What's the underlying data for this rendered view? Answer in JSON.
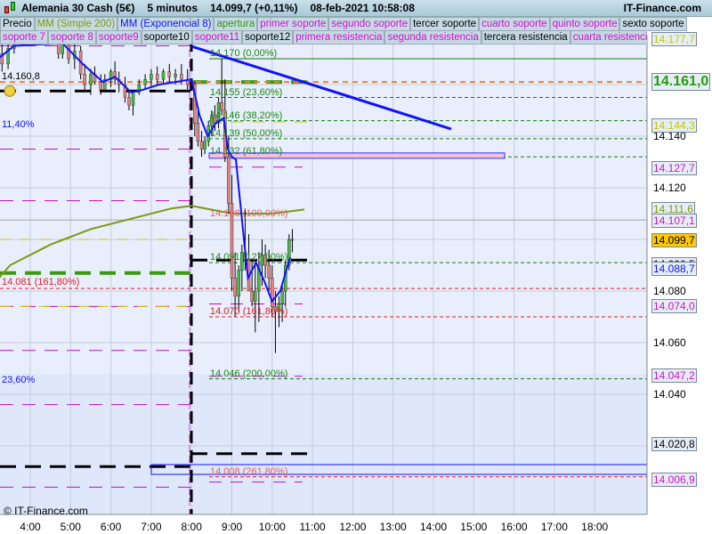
{
  "title": {
    "instrument": "Alemania 30 Cash (5€)",
    "timeframe": "5 minutos",
    "price": "14.099,7 (+0,11%)",
    "datetime": "08-feb-2021 10:58:08",
    "brand": "IT-Finance.com"
  },
  "legend_row1": [
    {
      "label": "Precio",
      "color": "#000000"
    },
    {
      "label": "MM (Simple 200)",
      "color": "#7a9a10"
    },
    {
      "label": "MM (Exponencial 8)",
      "color": "#1010ff"
    },
    {
      "label": "apertura",
      "color": "#2a9a10"
    },
    {
      "label": "primer soporte",
      "color": "#d010d0"
    },
    {
      "label": "segundo soporte",
      "color": "#d010d0"
    },
    {
      "label": "tercer soporte",
      "color": "#000000"
    },
    {
      "label": "cuarto soporte",
      "color": "#d010d0"
    },
    {
      "label": "quinto soporte",
      "color": "#d010d0"
    },
    {
      "label": "sexto soporte",
      "color": "#000000"
    }
  ],
  "legend_row2": [
    {
      "label": "soporte 7",
      "color": "#d010d0"
    },
    {
      "label": "soporte 8",
      "color": "#d010d0"
    },
    {
      "label": "soporte9",
      "color": "#d010d0"
    },
    {
      "label": "soporte10",
      "color": "#000000"
    },
    {
      "label": "soporte11",
      "color": "#d010d0"
    },
    {
      "label": "soporte12",
      "color": "#000000"
    },
    {
      "label": "primera resistencia",
      "color": "#d010d0"
    },
    {
      "label": "segunda resistencia",
      "color": "#d010d0"
    },
    {
      "label": "tercera resistencia",
      "color": "#000000"
    },
    {
      "label": "cuarta resistencia",
      "color": "#d010d0"
    },
    {
      "label": "quinta resistencia",
      "color": "#d010d0"
    }
  ],
  "price_labels": [
    {
      "text": "14.177,7",
      "price": 14177.7,
      "color": "#c8c800",
      "bg": "#e6eef5"
    },
    {
      "text": "14.161,0",
      "price": 14161.0,
      "color": "#2a9a10",
      "bg": "#e6eef5",
      "big": true
    },
    {
      "text": "14.144,3",
      "price": 14144.3,
      "color": "#c8c800",
      "bg": "#e6eef5"
    },
    {
      "text": "14.127,7",
      "price": 14127.7,
      "color": "#d010d0",
      "bg": "#e6eef5"
    },
    {
      "text": "14.111,6",
      "price": 14111.6,
      "color": "#7a9a10",
      "bg": "#e6eef5"
    },
    {
      "text": "14.107,1",
      "price": 14107.1,
      "color": "#d010d0",
      "bg": "#e6eef5"
    },
    {
      "text": "14.099,7",
      "price": 14099.7,
      "color": "#000000",
      "bg": "#ffc800"
    },
    {
      "text": "14.090,5",
      "price": 14090.5,
      "color": "#000000",
      "bg": "#e6eef5"
    },
    {
      "text": "14.088,7",
      "price": 14088.7,
      "color": "#1010ff",
      "bg": "#e6eef5"
    },
    {
      "text": "14.074,0",
      "price": 14074.0,
      "color": "#d010d0",
      "bg": "#e6eef5"
    },
    {
      "text": "14.047,2",
      "price": 14047.2,
      "color": "#d010d0",
      "bg": "#e6eef5"
    },
    {
      "text": "14.020,8",
      "price": 14020.8,
      "color": "#000000",
      "bg": "#e6eef5"
    },
    {
      "text": "14.006,9",
      "price": 14006.9,
      "color": "#d010d0",
      "bg": "#e6eef5"
    }
  ],
  "y_ticks": [
    {
      "text": "14.140",
      "price": 14140
    },
    {
      "text": "14.120",
      "price": 14120
    },
    {
      "text": "14.080",
      "price": 14080
    },
    {
      "text": "14.060",
      "price": 14060
    },
    {
      "text": "14.040",
      "price": 14040
    }
  ],
  "x_ticks": [
    {
      "text": "4:00",
      "h": 4
    },
    {
      "text": "5:00",
      "h": 5
    },
    {
      "text": "6:00",
      "h": 6
    },
    {
      "text": "7:00",
      "h": 7
    },
    {
      "text": "8:00",
      "h": 8
    },
    {
      "text": "9:00",
      "h": 9
    },
    {
      "text": "10:00",
      "h": 10
    },
    {
      "text": "11:00",
      "h": 11
    },
    {
      "text": "12:00",
      "h": 12
    },
    {
      "text": "13:00",
      "h": 13
    },
    {
      "text": "14:00",
      "h": 14
    },
    {
      "text": "15:00",
      "h": 15
    },
    {
      "text": "16:00",
      "h": 16
    },
    {
      "text": "17:00",
      "h": 17
    },
    {
      "text": "18:00",
      "h": 18
    }
  ],
  "fib_labels": [
    {
      "text": "14.170 (0,00%)",
      "price": 14170,
      "color": "#1a8a10"
    },
    {
      "text": "14.155 (23,60%)",
      "price": 14155,
      "color": "#1a8a10"
    },
    {
      "text": "14.146 (38,20%)",
      "price": 14146,
      "color": "#1a8a10"
    },
    {
      "text": "14.139 (50,00%)",
      "price": 14139,
      "color": "#1a8a10"
    },
    {
      "text": "14.132 (61,80%)",
      "price": 14132,
      "color": "#1a8a10"
    },
    {
      "text": "14.108 (100,00%)",
      "price": 14108,
      "color": "#e06060"
    },
    {
      "text": "14.091 (127,00%)",
      "price": 14091,
      "color": "#1a8a10"
    },
    {
      "text": "14.070 (161,80%)",
      "price": 14070,
      "color": "#e02020"
    },
    {
      "text": "14.046 (200,00%)",
      "price": 14046,
      "color": "#1a8a10"
    },
    {
      "text": "14.008 (261,80%)",
      "price": 14008,
      "color": "#e06060"
    }
  ],
  "left_labels": [
    {
      "text": "14.160,8",
      "price": 14160.8,
      "color": "#000000"
    },
    {
      "text": "11,40%",
      "price": 14142,
      "color": "#1010ff"
    },
    {
      "text": "14.081 (161,80%)",
      "price": 14081,
      "color": "#e02020"
    },
    {
      "text": "23,60%",
      "price": 14043,
      "color": "#1010ff"
    }
  ],
  "copyright": "© IT-Finance.com",
  "candles": [
    [
      3.3,
      14172,
      14178,
      14165,
      14168
    ],
    [
      3.45,
      14168,
      14176,
      14166,
      14174
    ],
    [
      3.6,
      14174,
      14180,
      14172,
      14178
    ],
    [
      4.7,
      14176,
      14180,
      14170,
      14172
    ],
    [
      4.8,
      14172,
      14178,
      14170,
      14176
    ],
    [
      4.95,
      14176,
      14179,
      14168,
      14170
    ],
    [
      5.1,
      14170,
      14177,
      14166,
      14173
    ],
    [
      5.25,
      14173,
      14175,
      14162,
      14164
    ],
    [
      5.35,
      14164,
      14168,
      14158,
      14160
    ],
    [
      5.5,
      14160,
      14166,
      14156,
      14164
    ],
    [
      5.6,
      14164,
      14167,
      14160,
      14161
    ],
    [
      5.75,
      14161,
      14164,
      14156,
      14158
    ],
    [
      5.85,
      14158,
      14164,
      14157,
      14162
    ],
    [
      6.0,
      14162,
      14166,
      14159,
      14165
    ],
    [
      6.1,
      14165,
      14169,
      14160,
      14162
    ],
    [
      6.2,
      14162,
      14165,
      14157,
      14160
    ],
    [
      6.35,
      14160,
      14163,
      14153,
      14155
    ],
    [
      6.45,
      14155,
      14158,
      14150,
      14152
    ],
    [
      6.55,
      14152,
      14158,
      14148,
      14157
    ],
    [
      6.7,
      14157,
      14162,
      14156,
      14160
    ],
    [
      6.85,
      14160,
      14164,
      14158,
      14162
    ],
    [
      7.0,
      14162,
      14166,
      14159,
      14164
    ],
    [
      7.15,
      14164,
      14167,
      14160,
      14162
    ],
    [
      7.3,
      14162,
      14166,
      14160,
      14165
    ],
    [
      7.45,
      14165,
      14168,
      14161,
      14163
    ],
    [
      7.6,
      14163,
      14166,
      14160,
      14164
    ],
    [
      7.75,
      14164,
      14168,
      14160,
      14162
    ],
    [
      7.9,
      14162,
      14166,
      14158,
      14160
    ],
    [
      8.08,
      14160,
      14161,
      14140,
      14145
    ],
    [
      8.16,
      14145,
      14150,
      14136,
      14138
    ],
    [
      8.25,
      14138,
      14142,
      14132,
      14135
    ],
    [
      8.33,
      14135,
      14140,
      14133,
      14138
    ],
    [
      8.42,
      14138,
      14146,
      14136,
      14144
    ],
    [
      8.5,
      14144,
      14150,
      14140,
      14148
    ],
    [
      8.58,
      14148,
      14152,
      14142,
      14145
    ],
    [
      8.67,
      14145,
      14155,
      14143,
      14153
    ],
    [
      8.75,
      14153,
      14170,
      14148,
      14150
    ],
    [
      8.83,
      14150,
      14162,
      14130,
      14132
    ],
    [
      8.92,
      14132,
      14140,
      14110,
      14114
    ],
    [
      9.0,
      14114,
      14125,
      14080,
      14085
    ],
    [
      9.08,
      14085,
      14095,
      14070,
      14078
    ],
    [
      9.17,
      14078,
      14090,
      14072,
      14088
    ],
    [
      9.25,
      14088,
      14098,
      14080,
      14095
    ],
    [
      9.33,
      14095,
      14112,
      14088,
      14092
    ],
    [
      9.42,
      14092,
      14102,
      14082,
      14080
    ],
    [
      9.5,
      14080,
      14092,
      14074,
      14076
    ],
    [
      9.58,
      14076,
      14090,
      14064,
      14080
    ],
    [
      9.67,
      14080,
      14095,
      14068,
      14090
    ],
    [
      9.75,
      14090,
      14100,
      14082,
      14094
    ],
    [
      9.83,
      14094,
      14098,
      14085,
      14090
    ],
    [
      9.92,
      14090,
      14096,
      14080,
      14085
    ],
    [
      10.0,
      14085,
      14090,
      14070,
      14074
    ],
    [
      10.08,
      14074,
      14080,
      14056,
      14072
    ],
    [
      10.17,
      14072,
      14078,
      14066,
      14075
    ],
    [
      10.25,
      14075,
      14082,
      14068,
      14080
    ],
    [
      10.33,
      14080,
      14092,
      14074,
      14090
    ],
    [
      10.42,
      14090,
      14102,
      14088,
      14100
    ],
    [
      10.5,
      14100,
      14104,
      14095,
      14099.7
    ]
  ],
  "ema": [
    [
      3.2,
      14170
    ],
    [
      3.6,
      14175
    ],
    [
      4.8,
      14176
    ],
    [
      5.3,
      14168
    ],
    [
      5.8,
      14161
    ],
    [
      6.1,
      14163
    ],
    [
      6.5,
      14157
    ],
    [
      6.8,
      14158
    ],
    [
      7.2,
      14160
    ],
    [
      7.6,
      14161
    ],
    [
      8.0,
      14162
    ],
    [
      8.2,
      14148
    ],
    [
      8.4,
      14140
    ],
    [
      8.6,
      14145
    ],
    [
      8.8,
      14147
    ],
    [
      8.9,
      14135
    ],
    [
      9.0,
      14132
    ],
    [
      9.1,
      14131
    ],
    [
      9.3,
      14100
    ],
    [
      9.4,
      14085
    ],
    [
      9.6,
      14091
    ],
    [
      9.8,
      14084
    ],
    [
      10.0,
      14076
    ],
    [
      10.2,
      14080
    ],
    [
      10.35,
      14088
    ],
    [
      10.45,
      14093
    ]
  ],
  "sma200": [
    [
      3.0,
      14081
    ],
    [
      3.5,
      14090
    ],
    [
      4.5,
      14098
    ],
    [
      5.5,
      14104
    ],
    [
      6.5,
      14108
    ],
    [
      7.5,
      14112
    ],
    [
      8.0,
      14113
    ],
    [
      9.0,
      14110
    ],
    [
      10.0,
      14110
    ],
    [
      10.8,
      14111.6
    ]
  ]
}
